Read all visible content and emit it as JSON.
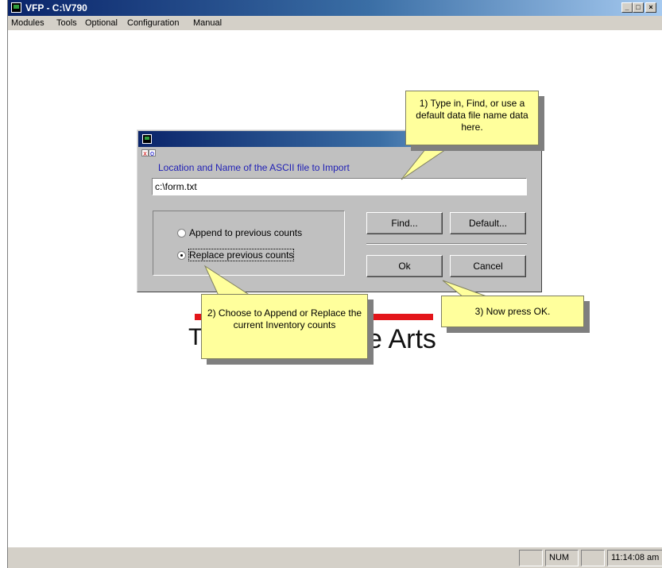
{
  "window": {
    "title": "VFP - C:\\V790"
  },
  "menu": {
    "items": [
      "Modules",
      "Tools",
      "Optional",
      "Configuration",
      "Manual"
    ]
  },
  "background": {
    "logo_text": "e Arts"
  },
  "dialog": {
    "label": "Location and Name of the ASCII file to Import",
    "file_value": "c:\\form.txt",
    "options": {
      "append": "Append to previous counts",
      "replace": "Replace previous counts",
      "selected": "replace"
    },
    "buttons": {
      "find": "Find...",
      "default": "Default...",
      "ok": "Ok",
      "cancel": "Cancel"
    }
  },
  "callouts": {
    "one": "1) Type in, Find, or use a default data file name data here.",
    "two": "2) Choose to Append or Replace the current Inventory counts",
    "three": "3) Now press OK."
  },
  "status": {
    "num": "NUM",
    "time": "11:14:08 am"
  },
  "colors": {
    "tooltip_bg": "#ffff9c",
    "title_bar": "#0a246a",
    "dialog_label": "#1f1fb5"
  }
}
